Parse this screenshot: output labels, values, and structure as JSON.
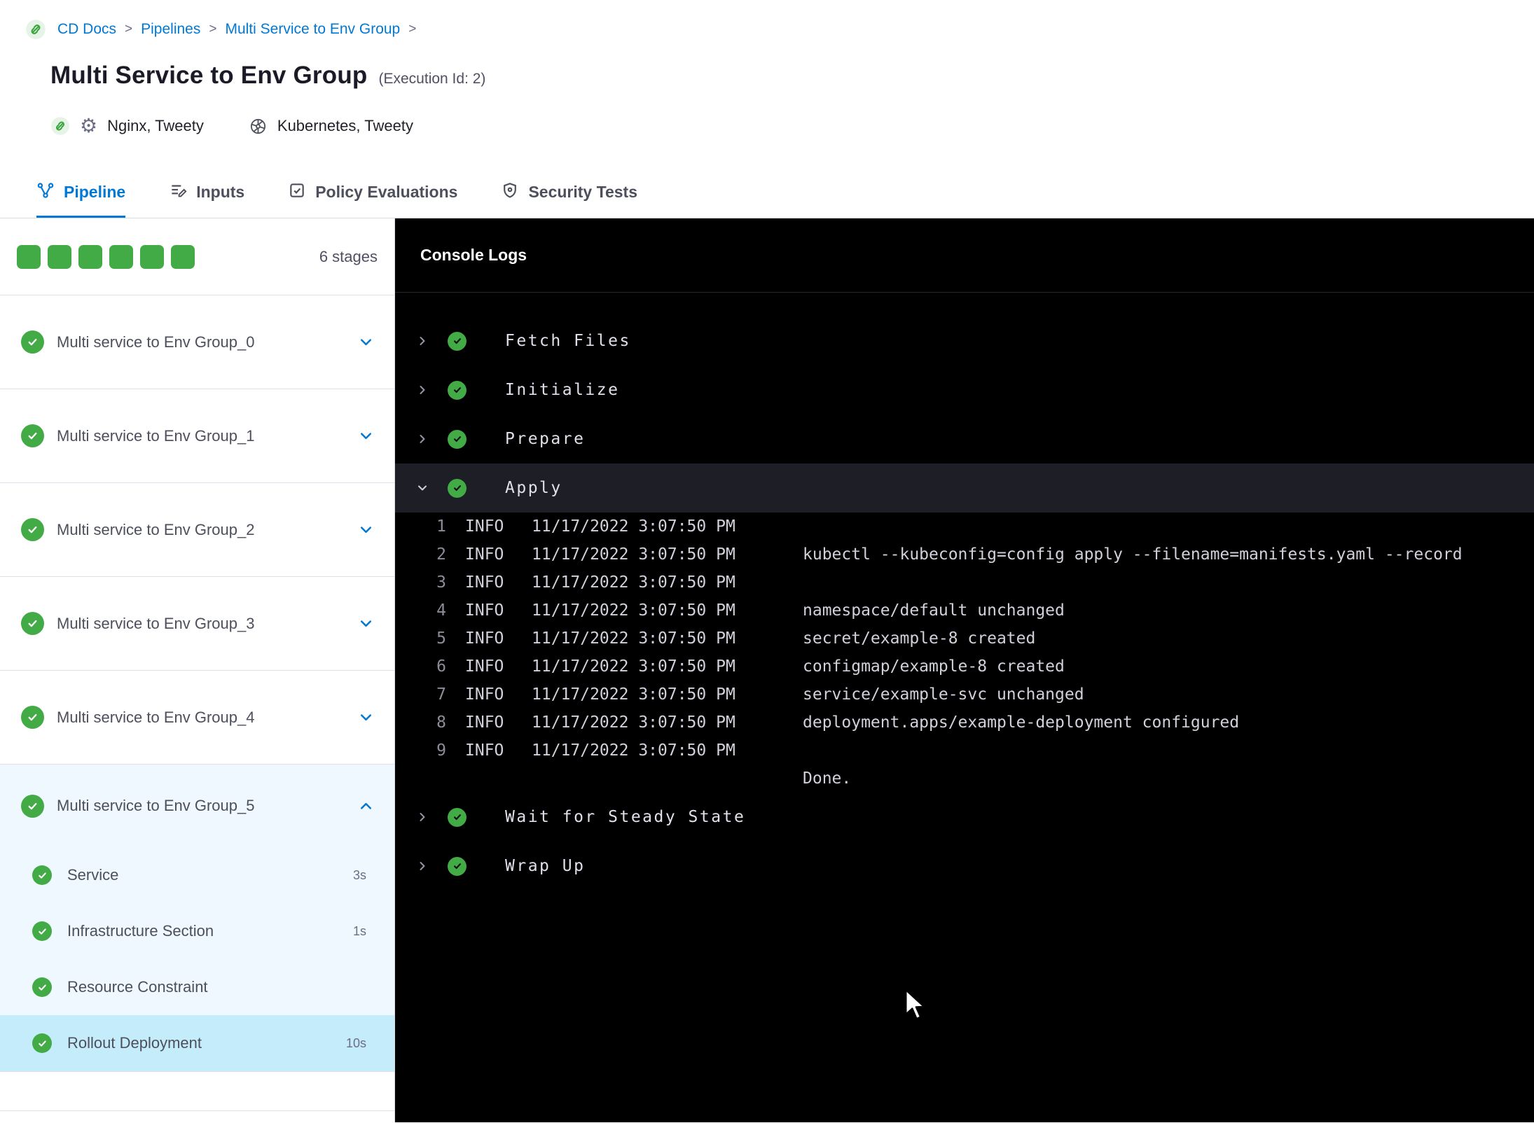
{
  "breadcrumb": {
    "items": [
      "CD Docs",
      "Pipelines",
      "Multi Service to Env Group"
    ],
    "separator": ">"
  },
  "header": {
    "title": "Multi Service to Env Group",
    "execution_id": "(Execution Id: 2)",
    "services": "Nginx, Tweety",
    "infrastructure": "Kubernetes, Tweety"
  },
  "tabs": {
    "pipeline": "Pipeline",
    "inputs": "Inputs",
    "policy": "Policy Evaluations",
    "security": "Security Tests"
  },
  "sidebar": {
    "stages_count": "6 stages",
    "stages": [
      {
        "name": "Multi service to Env Group_0"
      },
      {
        "name": "Multi service to Env Group_1"
      },
      {
        "name": "Multi service to Env Group_2"
      },
      {
        "name": "Multi service to Env Group_3"
      },
      {
        "name": "Multi service to Env Group_4"
      },
      {
        "name": "Multi service to Env Group_5",
        "steps": [
          {
            "name": "Service",
            "duration": "3s"
          },
          {
            "name": "Infrastructure Section",
            "duration": "1s"
          },
          {
            "name": "Resource Constraint",
            "duration": ""
          },
          {
            "name": "Rollout Deployment",
            "duration": "10s"
          }
        ]
      }
    ]
  },
  "console": {
    "title": "Console Logs",
    "steps": {
      "fetch": "Fetch Files",
      "initialize": "Initialize",
      "prepare": "Prepare",
      "apply": "Apply",
      "wait": "Wait for Steady State",
      "wrapup": "Wrap Up"
    },
    "logs": [
      {
        "num": "1",
        "level": "INFO",
        "time": "11/17/2022 3:07:50 PM",
        "msg": ""
      },
      {
        "num": "2",
        "level": "INFO",
        "time": "11/17/2022 3:07:50 PM",
        "msg": "kubectl --kubeconfig=config apply --filename=manifests.yaml --record"
      },
      {
        "num": "3",
        "level": "INFO",
        "time": "11/17/2022 3:07:50 PM",
        "msg": ""
      },
      {
        "num": "4",
        "level": "INFO",
        "time": "11/17/2022 3:07:50 PM",
        "msg": "namespace/default unchanged"
      },
      {
        "num": "5",
        "level": "INFO",
        "time": "11/17/2022 3:07:50 PM",
        "msg": "secret/example-8 created"
      },
      {
        "num": "6",
        "level": "INFO",
        "time": "11/17/2022 3:07:50 PM",
        "msg": "configmap/example-8 created"
      },
      {
        "num": "7",
        "level": "INFO",
        "time": "11/17/2022 3:07:50 PM",
        "msg": "service/example-svc unchanged"
      },
      {
        "num": "8",
        "level": "INFO",
        "time": "11/17/2022 3:07:50 PM",
        "msg": "deployment.apps/example-deployment configured"
      },
      {
        "num": "9",
        "level": "INFO",
        "time": "11/17/2022 3:07:50 PM",
        "msg": ""
      }
    ],
    "done": "Done."
  },
  "colors": {
    "accent": "#0278d5",
    "success": "#42ab45",
    "console_bg": "#000000",
    "selected_step_bg": "#c5ecfb"
  }
}
